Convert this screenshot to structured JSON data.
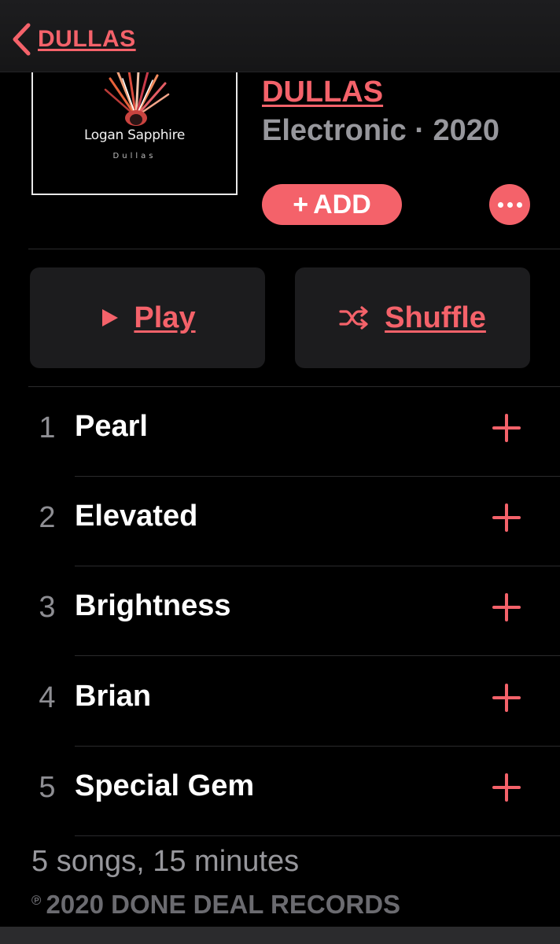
{
  "nav": {
    "back_label": "DULLAS"
  },
  "artwork": {
    "title": "Logan Sapphire",
    "subtitle": "Dullas"
  },
  "album": {
    "title": "DULLAS",
    "meta": "Electronic · 2020",
    "add_label": "ADD",
    "add_prefix": "+",
    "accent_color": "#f4626a"
  },
  "actions": {
    "play_label": "Play",
    "shuffle_label": "Shuffle"
  },
  "tracks": [
    {
      "number": "1",
      "title": "Pearl"
    },
    {
      "number": "2",
      "title": "Elevated"
    },
    {
      "number": "3",
      "title": "Brightness"
    },
    {
      "number": "4",
      "title": "Brian"
    },
    {
      "number": "5",
      "title": "Special Gem"
    }
  ],
  "footer": {
    "summary": "5 songs, 15 minutes",
    "p_mark": "℗",
    "copyright": "2020 DONE DEAL RECORDS"
  }
}
